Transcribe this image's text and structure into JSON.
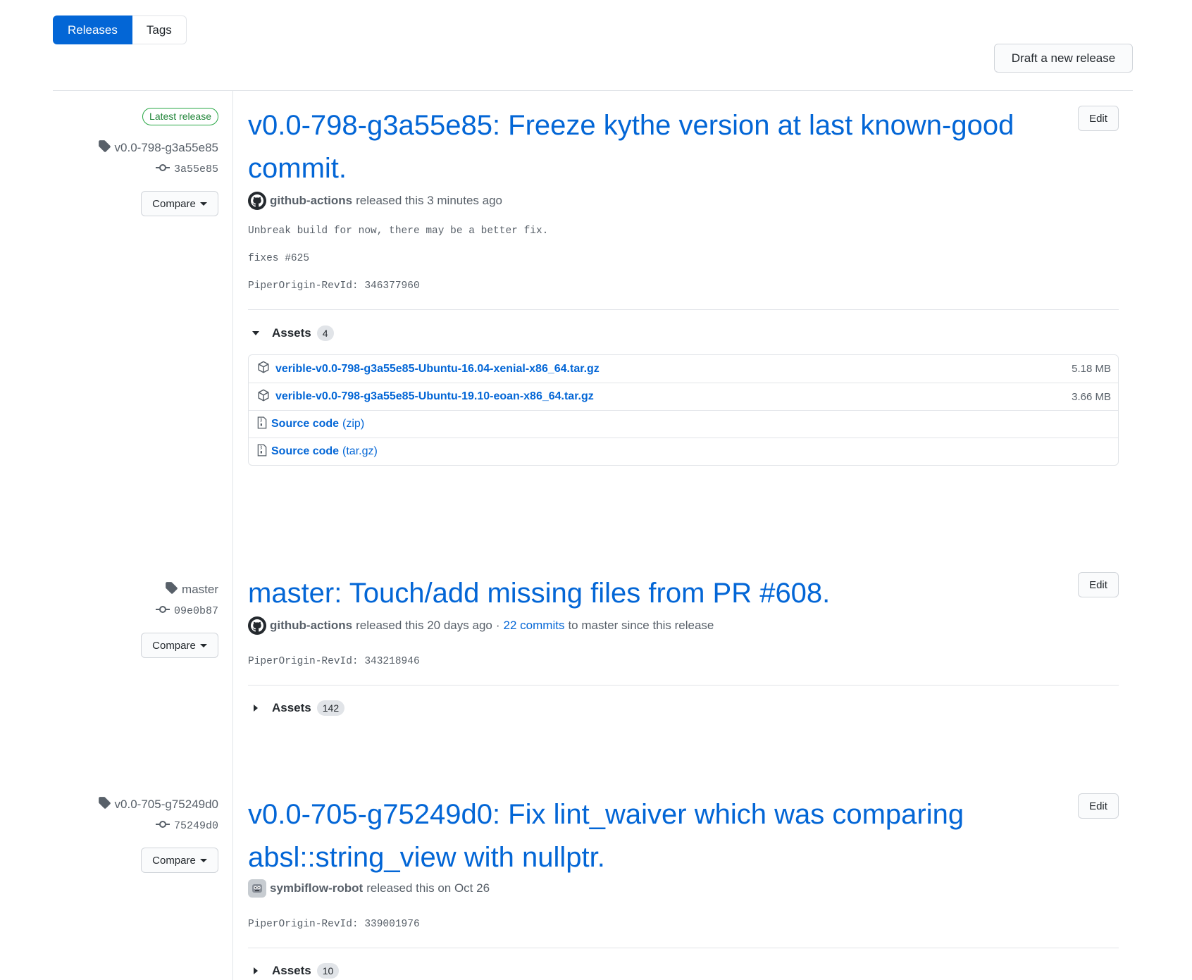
{
  "nav": {
    "releases_label": "Releases",
    "tags_label": "Tags"
  },
  "header": {
    "draft_label": "Draft a new release"
  },
  "releases": [
    {
      "badge": "Latest release",
      "tag": "v0.0-798-g3a55e85",
      "commit": "3a55e85",
      "compare_label": "Compare",
      "edit_label": "Edit",
      "title": "v0.0-798-g3a55e85: Freeze kythe version at last known-good commit.",
      "author": "github-actions",
      "released_text": "released this 3 minutes ago",
      "body": [
        "Unbreak build for now, there may be a better fix.",
        "fixes #625",
        "PiperOrigin-RevId: 346377960"
      ],
      "assets_label": "Assets",
      "assets_count": "4",
      "assets": [
        {
          "name": "verible-v0.0-798-g3a55e85-Ubuntu-16.04-xenial-x86_64.tar.gz",
          "size": "5.18 MB"
        },
        {
          "name": "verible-v0.0-798-g3a55e85-Ubuntu-19.10-eoan-x86_64.tar.gz",
          "size": "3.66 MB"
        },
        {
          "name": "Source code",
          "suffix": "(zip)"
        },
        {
          "name": "Source code",
          "suffix": "(tar.gz)"
        }
      ]
    },
    {
      "tag": "master",
      "commit": "09e0b87",
      "compare_label": "Compare",
      "edit_label": "Edit",
      "title": "master: Touch/add missing files from PR #608.",
      "author": "github-actions",
      "released_text": "released this 20 days ago",
      "separator": "·",
      "commits_link": "22 commits",
      "commits_suffix": "to master since this release",
      "body": [
        "PiperOrigin-RevId: 343218946"
      ],
      "assets_label": "Assets",
      "assets_count": "142"
    },
    {
      "tag": "v0.0-705-g75249d0",
      "commit": "75249d0",
      "compare_label": "Compare",
      "edit_label": "Edit",
      "title": "v0.0-705-g75249d0: Fix lint_waiver which was comparing absl::string_view with nullptr.",
      "author": "symbiflow-robot",
      "released_text": "released this on Oct 26",
      "body": [
        "PiperOrigin-RevId: 339001976"
      ],
      "assets_label": "Assets",
      "assets_count": "10"
    }
  ],
  "colors": {
    "accent": "#0366d6",
    "latest_green": "#28a745",
    "muted": "#586069",
    "border": "#e1e4e8"
  }
}
